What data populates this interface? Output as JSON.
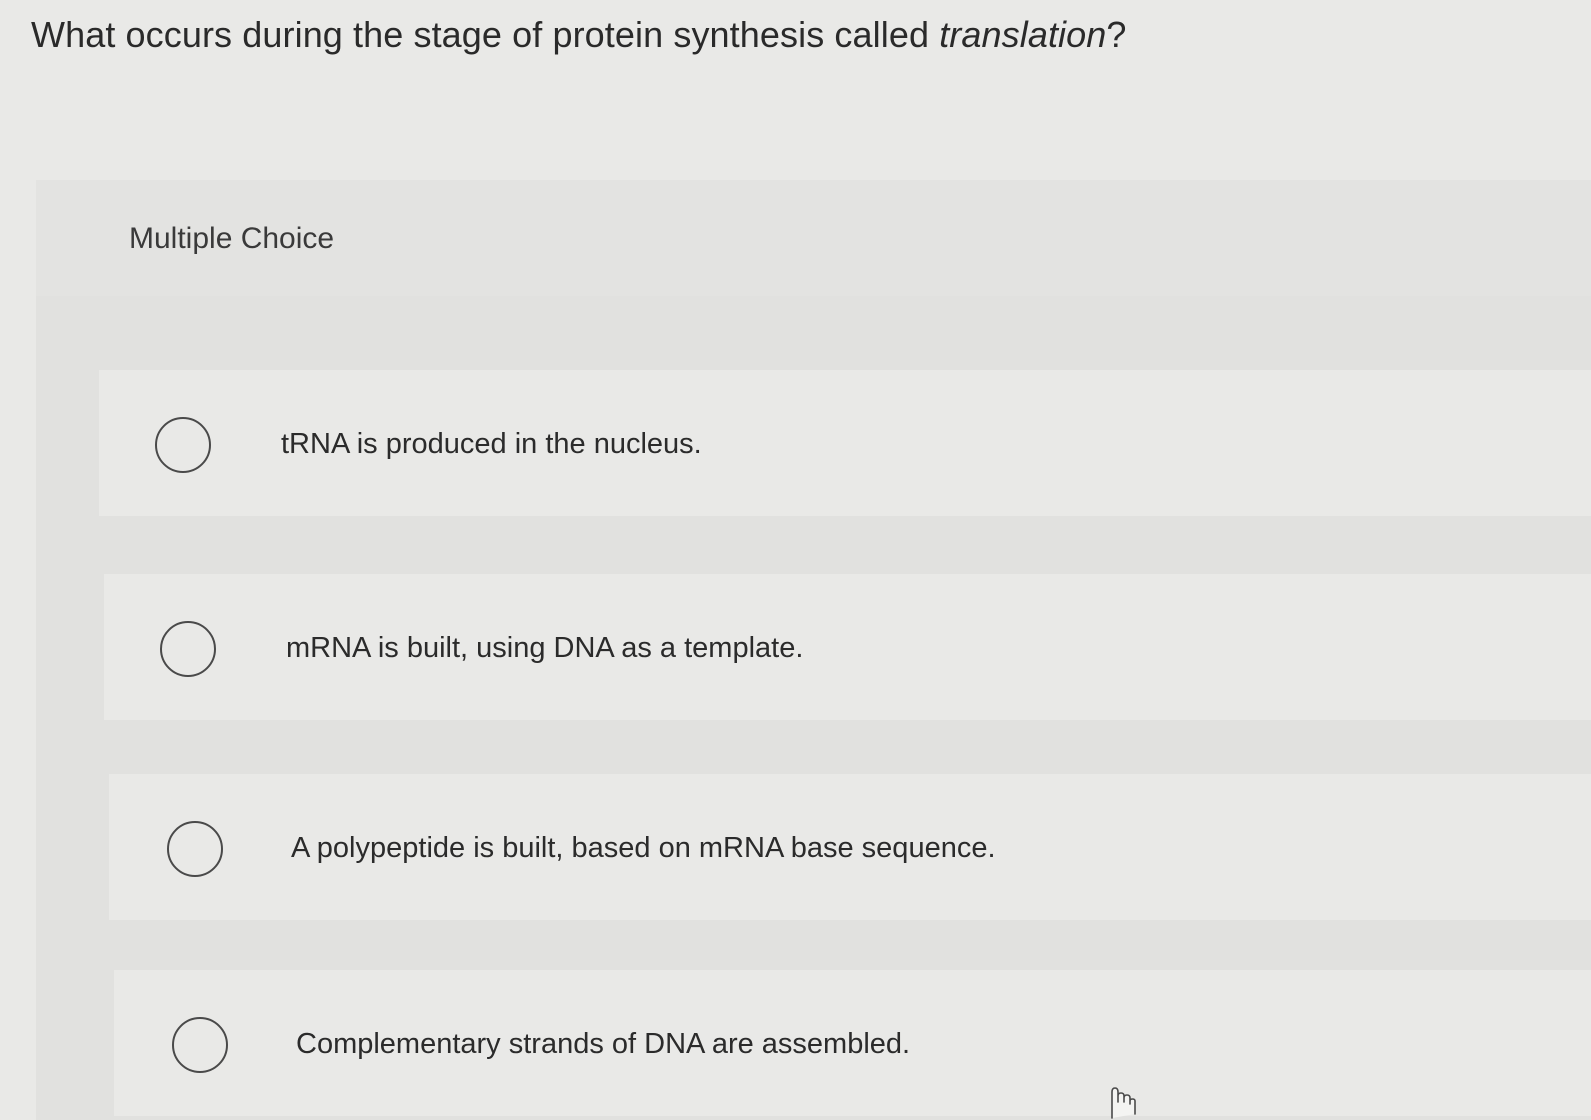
{
  "question": {
    "prefix": "What occurs during the stage of protein synthesis called ",
    "emphasis": "translation",
    "suffix": "?"
  },
  "quiz": {
    "type_label": "Multiple Choice",
    "options": [
      {
        "label": "tRNA is produced in the nucleus.",
        "selected": false
      },
      {
        "label": "mRNA is built, using DNA as a template.",
        "selected": false
      },
      {
        "label": "A polypeptide is built, based on mRNA base sequence.",
        "selected": false
      },
      {
        "label": "Complementary strands of DNA are assembled.",
        "selected": false
      }
    ]
  },
  "icons": {
    "radio": "radio-unchecked-icon",
    "cursor": "hand-pointer-icon"
  }
}
